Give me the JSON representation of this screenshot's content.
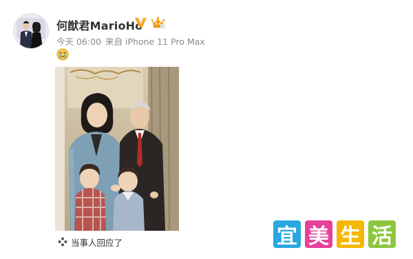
{
  "post": {
    "username": "何猷君MarioHo",
    "verified_badge": "v-verified-badge-icon",
    "member_badge": "crown-member-icon",
    "time": "今天 06:00",
    "source": "来自 iPhone 11 Pro Max",
    "emoji": "sad-crying-emoji",
    "photo_description_icon": "family-photo"
  },
  "footer": {
    "reply_icon": "flower-reply-icon",
    "reply_text": "当事人回应了"
  },
  "watermark": {
    "chars": [
      "宜",
      "美",
      "生",
      "活"
    ],
    "colors": [
      "#29a8e0",
      "#e8409a",
      "#f5b800",
      "#8dc63f"
    ]
  }
}
